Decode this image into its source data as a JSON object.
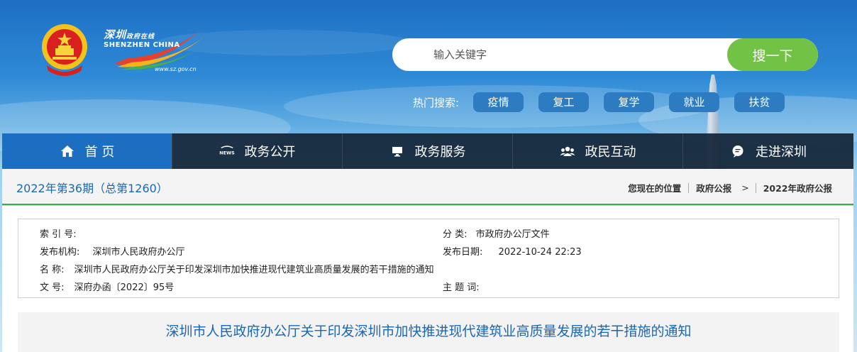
{
  "header": {
    "logo_cn": "深圳",
    "logo_cn_sub": "政府在线",
    "logo_en": "SHENZHEN CHINA",
    "logo_url": "www.sz.gov.cn",
    "search": {
      "placeholder": "输入关键字",
      "button_label": "搜一下"
    },
    "hot": {
      "label": "热门搜索:",
      "tags": [
        "疫情",
        "复工",
        "复学",
        "就业",
        "扶贫"
      ]
    }
  },
  "nav": {
    "items": [
      {
        "label": "首 页",
        "icon": "home-icon"
      },
      {
        "label": "政务公开",
        "icon": "news-icon"
      },
      {
        "label": "政务服务",
        "icon": "monitor-icon"
      },
      {
        "label": "政民互动",
        "icon": "people-icon"
      },
      {
        "label": "走进深圳",
        "icon": "chat-icon"
      }
    ]
  },
  "breadcrumb": {
    "issue": "2022年第36期（总第1260）",
    "location_label": "您现在的位置",
    "items": [
      "政府公报",
      "2022年政府公报"
    ],
    "separator": ">"
  },
  "meta": {
    "index_key": "索 引 号:",
    "index_val": "",
    "category_key": "分 类:",
    "category_val": "市政府办公厅文件",
    "publisher_key": "发布机构:",
    "publisher_val": "深圳市人民政府办公厅",
    "date_key": "发布日期:",
    "date_val": "2022-10-24 22:23",
    "name_key": "名 称:",
    "name_val": "深圳市人民政府办公厅关于印发深圳市加快推进现代建筑业高质量发展的若干措施的通知",
    "docno_key": "文 号:",
    "docno_val": "深府办函〔2022〕95号",
    "subject_key": "主 题 词:",
    "subject_val": ""
  },
  "document": {
    "title": "深圳市人民政府办公厅关于印发深圳市加快推进现代建筑业高质量发展的若干措施的通知"
  },
  "colors": {
    "nav_active": "#1c6ec1",
    "search_button": "#72c246",
    "hot_tag": "#2d7bc0",
    "accent_text": "#1b67b4",
    "bar_border": "#3fae49"
  }
}
